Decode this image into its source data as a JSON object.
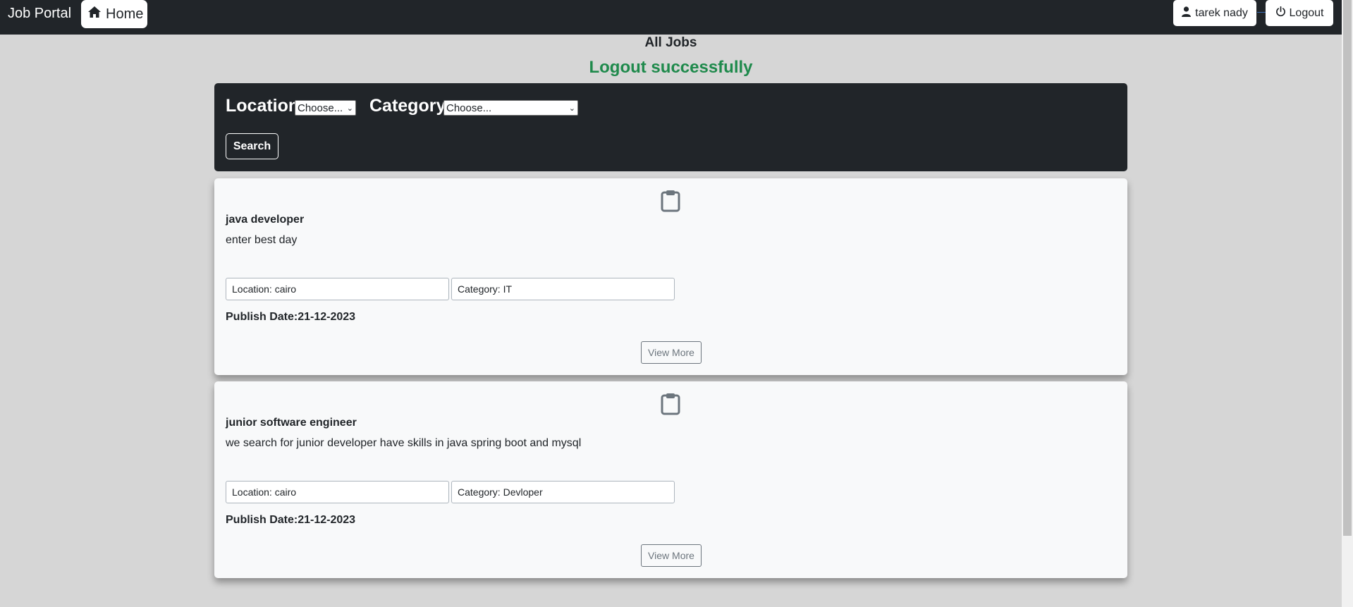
{
  "navbar": {
    "brand": "Job Portal",
    "home_label": "Home",
    "user_label": "tarek nady",
    "logout_label": "Logout"
  },
  "page": {
    "title": "All Jobs",
    "flash_message": "Logout successfully",
    "flash_color": "#1f8a4c"
  },
  "filter": {
    "location_label": "Location",
    "location_selected": "Choose...",
    "category_label": "Category",
    "category_selected": "Choose...",
    "search_label": "Search"
  },
  "jobs": [
    {
      "icon": "clipboard-icon",
      "title": "java developer",
      "description": "enter best day",
      "location": "Location: cairo",
      "category": "Category: IT",
      "publish": "Publish Date:21-12-2023",
      "view_label": "View More"
    },
    {
      "icon": "clipboard-icon",
      "title": "junior software engineer",
      "description": "we search for junior developer have skills in java spring boot and mysql",
      "location": "Location: cairo",
      "category": "Category: Devloper",
      "publish": "Publish Date:21-12-2023",
      "view_label": "View More"
    }
  ]
}
